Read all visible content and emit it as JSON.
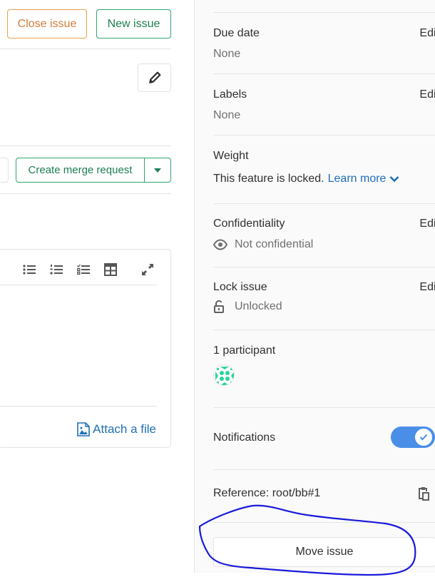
{
  "header": {
    "close_issue_label": "Close issue",
    "new_issue_label": "New issue"
  },
  "merge_request": {
    "create_label": "Create merge request"
  },
  "editor": {
    "toolbar_icons": [
      "bulleted-list-icon",
      "numbered-list-icon",
      "task-list-icon",
      "table-icon",
      "fullscreen-icon"
    ],
    "attach_label": "Attach a file"
  },
  "sidebar": {
    "due_date": {
      "title": "Due date",
      "edit": "Edit",
      "value": "None"
    },
    "labels": {
      "title": "Labels",
      "edit": "Edit",
      "value": "None"
    },
    "weight": {
      "title": "Weight",
      "text": "This feature is locked.",
      "link": "Learn more"
    },
    "confidentiality": {
      "title": "Confidentiality",
      "edit": "Edit",
      "value": "Not confidential"
    },
    "lock": {
      "title": "Lock issue",
      "edit": "Edit",
      "value": "Unlocked"
    },
    "participants": {
      "title": "1 participant",
      "count": 1
    },
    "notifications": {
      "title": "Notifications",
      "enabled": true
    },
    "reference": {
      "text": "Reference: root/bb#1"
    },
    "move_issue_label": "Move issue"
  },
  "colors": {
    "close_issue": "#d17d3a",
    "success": "#1d7e54",
    "link": "#1f6fb5",
    "toggle_on": "#4a8ee8",
    "annotation": "#1a1adb",
    "avatar": "#2bd49a"
  }
}
